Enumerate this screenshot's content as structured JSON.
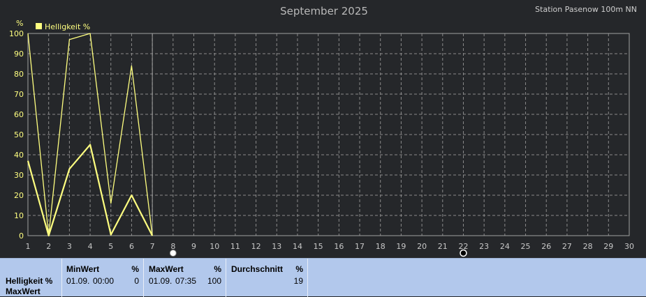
{
  "header": {
    "title": "September 2025",
    "station": "Station Pasenow 100m NN"
  },
  "chart_data": {
    "type": "line",
    "title": "September 2025",
    "ylabel": "%",
    "xlim": [
      1,
      30
    ],
    "ylim": [
      0,
      100
    ],
    "x_ticks": [
      1,
      2,
      3,
      4,
      5,
      6,
      7,
      8,
      9,
      10,
      11,
      12,
      13,
      14,
      15,
      16,
      17,
      18,
      19,
      20,
      21,
      22,
      23,
      24,
      25,
      26,
      27,
      28,
      29,
      30
    ],
    "y_ticks": [
      0,
      10,
      20,
      30,
      40,
      50,
      60,
      70,
      80,
      90,
      100
    ],
    "grid": true,
    "legend": "top-left",
    "current_day": 7,
    "series": [
      {
        "name": "Helligkeit %",
        "role": "max",
        "color": "#ffff80",
        "x": [
          1,
          2,
          3,
          4,
          5,
          6,
          7
        ],
        "values": [
          100,
          0,
          97,
          100,
          16,
          84,
          0
        ]
      },
      {
        "name": "",
        "role": "mean",
        "color": "#ffff80",
        "x": [
          1,
          2,
          3,
          4,
          5,
          6,
          7
        ],
        "values": [
          37,
          0,
          33,
          45,
          0.5,
          20,
          0
        ]
      }
    ],
    "markers": [
      {
        "x": 8,
        "symbol": "full-moon"
      },
      {
        "x": 22,
        "symbol": "new-moon"
      }
    ]
  },
  "stats": {
    "row_label": "Helligkeit %",
    "row_sublabel": "MaxWert",
    "min": {
      "header": "MinWert",
      "unit": "%",
      "date": "01.09.",
      "time": "00:00",
      "value": "0"
    },
    "max": {
      "header": "MaxWert",
      "unit": "%",
      "date": "01.09.",
      "time": "07:35",
      "value": "100"
    },
    "avg": {
      "header": "Durchschnitt",
      "unit": "%",
      "value": "19"
    }
  }
}
